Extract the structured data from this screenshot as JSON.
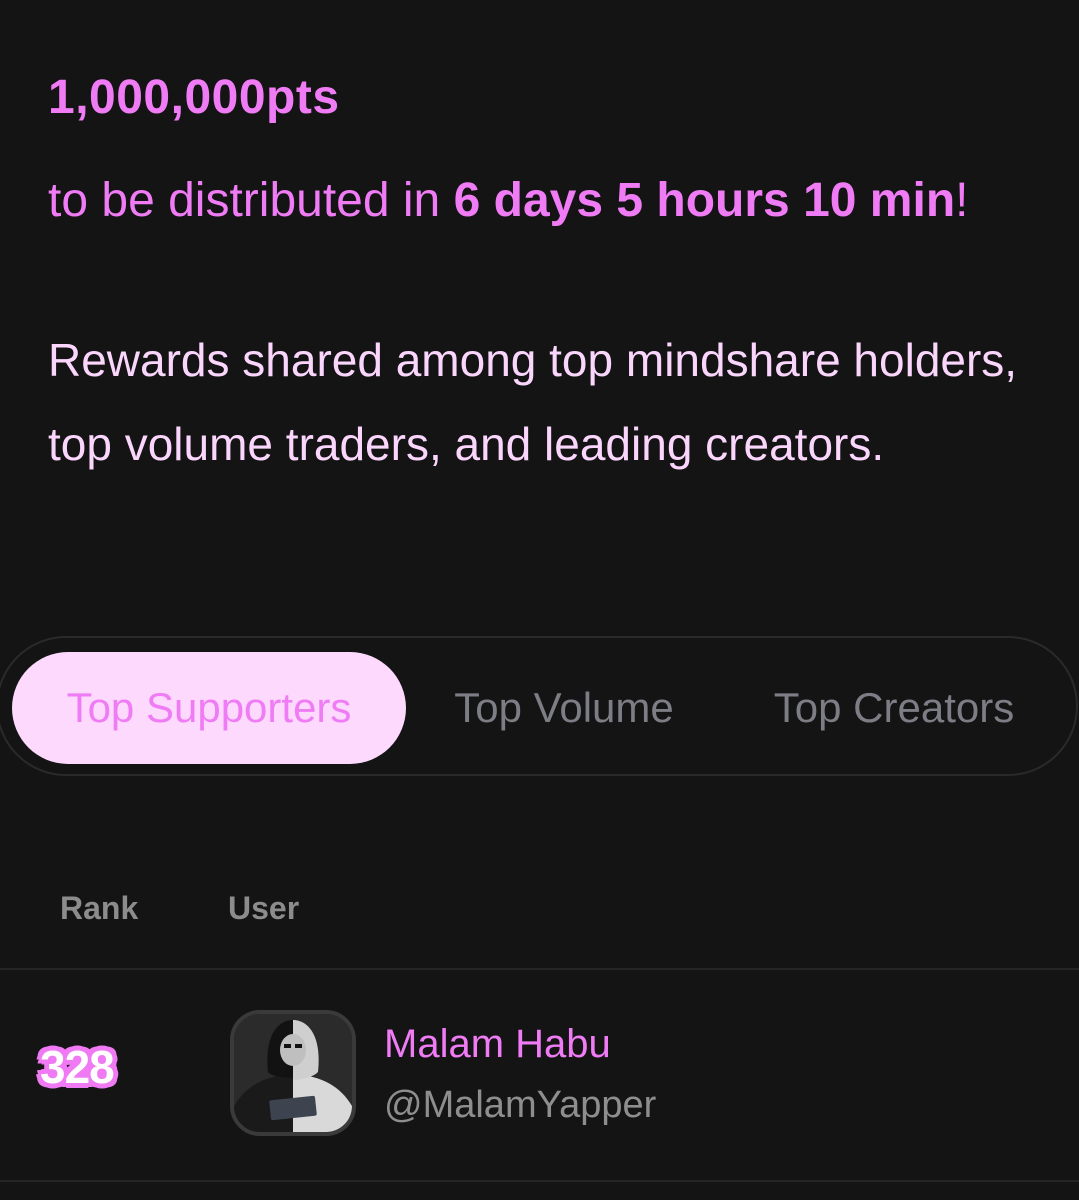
{
  "reward": {
    "amount": "1,000,000pts",
    "distribution_prefix": "to be distributed in ",
    "countdown": "6 days 5 hours 10 min",
    "distribution_suffix": "!",
    "description": "Rewards shared among top mindshare holders, top volume traders, and leading creators."
  },
  "tabs": [
    {
      "label": "Top Supporters",
      "active": true
    },
    {
      "label": "Top Volume",
      "active": false
    },
    {
      "label": "Top Creators",
      "active": false
    }
  ],
  "table": {
    "headers": {
      "rank": "Rank",
      "user": "User"
    },
    "rows": [
      {
        "rank": "328",
        "name": "Malam Habu",
        "handle": "@MalamYapper",
        "avatar_icon": "hooded-figure-avatar"
      }
    ]
  },
  "colors": {
    "background": "#141414",
    "accent": "#f07cf5",
    "accent_light": "#fbd6fc",
    "active_tab_bg": "#fcd9fd",
    "inactive_tab_text": "#7d7d86",
    "muted_text": "#8e8e8e"
  }
}
